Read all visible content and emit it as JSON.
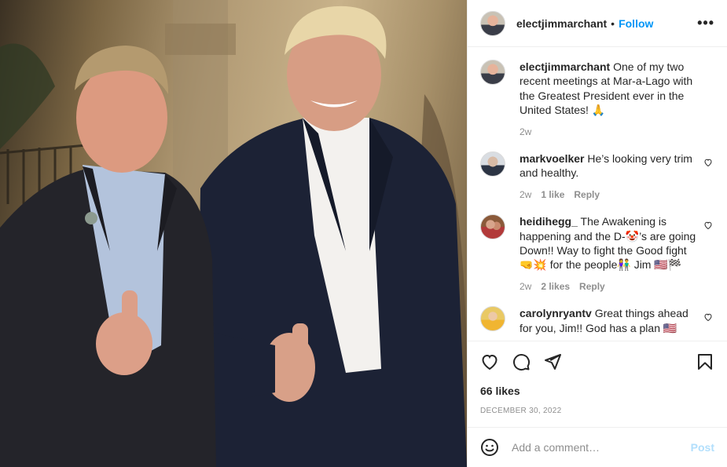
{
  "post": {
    "username": "electjimmarchant",
    "follow_label": "Follow",
    "dot": "•",
    "more_label": "•••",
    "caption": {
      "username": "electjimmarchant",
      "text": "One of my two recent meetings at Mar-a-Lago with the Greatest President ever in the United States! 🙏",
      "time": "2w"
    },
    "comments": [
      {
        "username": "markvoelker",
        "text": "He’s looking very trim and healthy.",
        "time": "2w",
        "likes": "1 like",
        "reply": "Reply"
      },
      {
        "username": "heidihegg_",
        "text": "The Awakening is happening and the D-🤡’s are going Down!! Way to fight the Good fight 🤜💥 for the people👫 Jim 🇺🇸🏁",
        "time": "2w",
        "likes": "2 likes",
        "reply": "Reply"
      },
      {
        "username": "carolynryantv",
        "text": "Great things ahead for you, Jim!! God has a plan 🇺🇸"
      }
    ],
    "likes_count": "66 likes",
    "date": "DECEMBER 30, 2022",
    "add_comment_placeholder": "Add a comment…",
    "post_label": "Post"
  },
  "icons": [
    "heart-icon",
    "comment-icon",
    "share-icon",
    "bookmark-icon",
    "smiley-icon",
    "more-icon"
  ],
  "colors": {
    "accent": "#0095f6",
    "post_disabled": "#b2dffc",
    "muted": "#8e8e8e",
    "text": "#262626"
  }
}
